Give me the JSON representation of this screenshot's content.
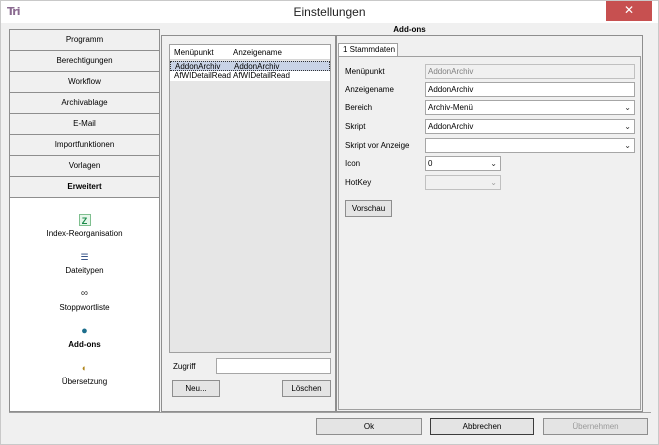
{
  "window": {
    "title": "Einstellungen",
    "app_icon": "Tri",
    "close_glyph": "✕"
  },
  "sidebar": {
    "nav": [
      "Programm",
      "Berechtigungen",
      "Workflow",
      "Archivablage",
      "E-Mail",
      "Importfunktionen",
      "Vorlagen",
      "Erweitert"
    ],
    "active_nav": "Erweitert",
    "tools": [
      {
        "label": "Index-Reorganisation",
        "icon": "index-reorg-icon",
        "glyph": "Z"
      },
      {
        "label": "Dateitypen",
        "icon": "file-types-icon",
        "glyph": "☰"
      },
      {
        "label": "Stoppwortliste",
        "icon": "stopword-list-icon",
        "glyph": "∞"
      },
      {
        "label": "Add-ons",
        "icon": "globe-icon",
        "glyph": "●"
      },
      {
        "label": "Übersetzung",
        "icon": "translation-icon",
        "glyph": "◐"
      }
    ],
    "active_tool": "Add-ons"
  },
  "panel": {
    "title": "Add-ons"
  },
  "list": {
    "columns": [
      "Menüpunkt",
      "Anzeigename"
    ],
    "rows": [
      {
        "menupunkt": "AddonArchiv",
        "anzeigename": "AddonArchiv"
      },
      {
        "menupunkt": "AfWIDetailRead",
        "anzeigename": "AfWIDetailRead"
      }
    ]
  },
  "zugriff": {
    "label": "Zugriff",
    "value": ""
  },
  "buttons": {
    "new": "Neu...",
    "delete": "Löschen",
    "preview": "Vorschau",
    "ok": "Ok",
    "cancel": "Abbrechen",
    "apply": "Übernehmen"
  },
  "tab": {
    "label": "1 Stammdaten"
  },
  "form": {
    "menupunkt_label": "Menüpunkt",
    "menupunkt_value": "AddonArchiv",
    "anzeigename_label": "Anzeigename",
    "anzeigename_value": "AddonArchiv",
    "bereich_label": "Bereich",
    "bereich_value": "Archiv-Menü",
    "skript_label": "Skript",
    "skript_value": "AddonArchiv",
    "skript_vor_label": "Skript vor Anzeige",
    "skript_vor_value": "",
    "icon_label": "Icon",
    "icon_value": "0",
    "hotkey_label": "HotKey",
    "hotkey_value": ""
  }
}
